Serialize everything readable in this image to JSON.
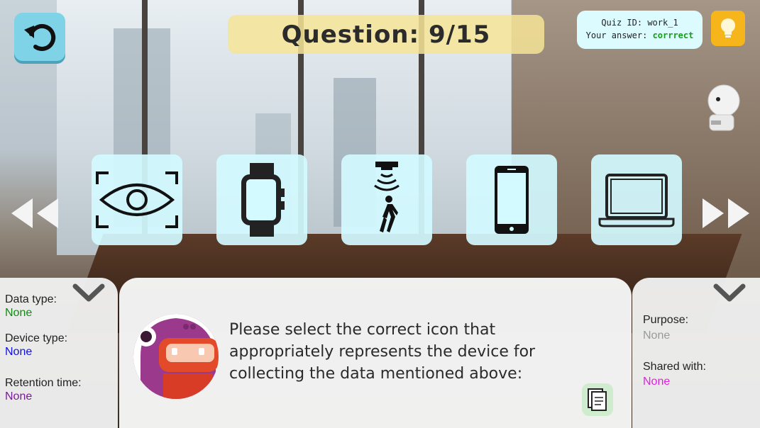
{
  "header": {
    "question_label": "Question: 9/15",
    "quiz_id_text": "Quiz ID: work_1",
    "your_answer_label": "Your answer:",
    "your_answer_value": "corrrect"
  },
  "icons": {
    "undo": "undo-icon",
    "hint": "lightbulb-icon",
    "prev": "rewind-icon",
    "next": "fast-forward-icon",
    "cards": [
      "eye-scan-icon",
      "smartwatch-icon",
      "motion-sensor-icon",
      "smartphone-icon",
      "laptop-icon"
    ]
  },
  "left_panel": {
    "data_type_label": "Data type:",
    "data_type_value": "None",
    "device_type_label": "Device type:",
    "device_type_value": "None",
    "retention_label": "Retention time:",
    "retention_value": "None"
  },
  "right_panel": {
    "purpose_label": "Purpose:",
    "purpose_value": "None",
    "shared_label": "Shared with:",
    "shared_value": "None"
  },
  "dialog": {
    "text": "Please select the correct icon that appropriately represents the device for collecting the data mentioned above:"
  },
  "colors": {
    "data_type": "#128a12",
    "device_type": "#1010e0",
    "retention": "#7a1a9a",
    "purpose": "#9a9a9a",
    "shared": "#e020e0"
  }
}
